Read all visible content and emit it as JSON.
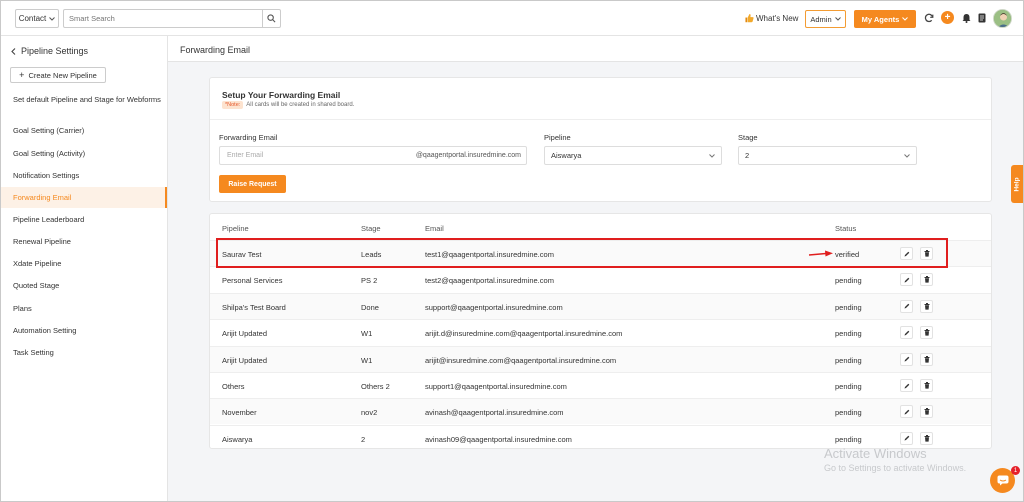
{
  "topbar": {
    "contact_select": "Contact",
    "search_placeholder": "Smart Search",
    "whats_new": "What's New",
    "role_select": "Admin",
    "my_agents": "My Agents"
  },
  "sidebar": {
    "title": "Pipeline Settings",
    "create_button": "Create New Pipeline",
    "items": [
      {
        "label": "Set default Pipeline and Stage for Webforms",
        "active": false
      },
      {
        "label": "Goal Setting (Carrier)",
        "active": false
      },
      {
        "label": "Goal Setting (Activity)",
        "active": false
      },
      {
        "label": "Notification Settings",
        "active": false
      },
      {
        "label": "Forwarding Email",
        "active": true
      },
      {
        "label": "Pipeline Leaderboard",
        "active": false
      },
      {
        "label": "Renewal Pipeline",
        "active": false
      },
      {
        "label": "Xdate Pipeline",
        "active": false
      },
      {
        "label": "Quoted Stage",
        "active": false
      },
      {
        "label": "Plans",
        "active": false
      },
      {
        "label": "Automation Setting",
        "active": false
      },
      {
        "label": "Task Setting",
        "active": false
      }
    ]
  },
  "main": {
    "title": "Forwarding Email",
    "setup": {
      "title": "Setup Your Forwarding Email",
      "note_tag": "*Note:",
      "note_text": "All cards will be created in shared board.",
      "forwarding_label": "Forwarding Email",
      "email_placeholder": "Enter Email",
      "email_domain": "@qaagentportal.insuredmine.com",
      "pipeline_label": "Pipeline",
      "pipeline_value": "Aiswarya",
      "stage_label": "Stage",
      "stage_value": "2",
      "raise_button": "Raise Request"
    },
    "table": {
      "headers": [
        "Pipeline",
        "Stage",
        "Email",
        "Status"
      ],
      "rows": [
        {
          "pipeline": "Saurav Test",
          "stage": "Leads",
          "email": "test1@qaagentportal.insuredmine.com",
          "status": "verified"
        },
        {
          "pipeline": "Personal Services",
          "stage": "PS 2",
          "email": "test2@qaagentportal.insuredmine.com",
          "status": "pending"
        },
        {
          "pipeline": "Shilpa's Test Board",
          "stage": "Done",
          "email": "support@qaagentportal.insuredmine.com",
          "status": "pending"
        },
        {
          "pipeline": "Arijit Updated",
          "stage": "W1",
          "email": "arijit.d@insuredmine.com@qaagentportal.insuredmine.com",
          "status": "pending"
        },
        {
          "pipeline": "Arijit Updated",
          "stage": "W1",
          "email": "arijit@insuredmine.com@qaagentportal.insuredmine.com",
          "status": "pending"
        },
        {
          "pipeline": "Others",
          "stage": "Others 2",
          "email": "support1@qaagentportal.insuredmine.com",
          "status": "pending"
        },
        {
          "pipeline": "November",
          "stage": "nov2",
          "email": "avinash@qaagentportal.insuredmine.com",
          "status": "pending"
        },
        {
          "pipeline": "Aiswarya",
          "stage": "2",
          "email": "avinash09@qaagentportal.insuredmine.com",
          "status": "pending"
        }
      ]
    }
  },
  "help_tab": "Help",
  "watermark": {
    "line1": "Activate Windows",
    "line2": "Go to Settings to activate Windows."
  },
  "chat_badge": "1",
  "colors": {
    "accent": "#f5891f",
    "highlight": "#e01e1e"
  }
}
